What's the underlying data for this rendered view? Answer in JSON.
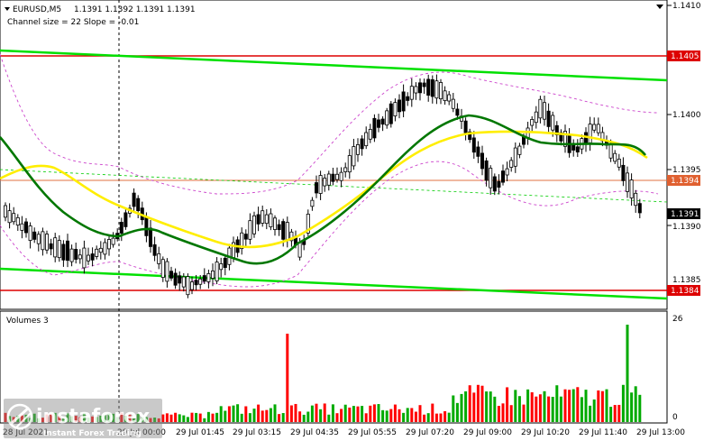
{
  "header": {
    "symbol": "EURUSD,M5",
    "ohlc": "1.1391 1.1392 1.1391 1.1391",
    "indicator": "Channel size = 22 Slope = -0.01"
  },
  "price_axis": {
    "labels": [
      "1.1410",
      "1.1405",
      "1.1400",
      "1.1395",
      "1.1394",
      "1.1391",
      "1.1390",
      "1.1385",
      "1.1384"
    ]
  },
  "volume_panel": {
    "title": "Volumes 3",
    "axis_labels": [
      "26",
      "0"
    ]
  },
  "time_axis": {
    "labels": [
      "28 Jul 2021",
      "29 Jul 00:00",
      "29 Jul 01:45",
      "29 Jul 03:15",
      "29 Jul 04:35",
      "29 Jul 05:55",
      "29 Jul 07:20",
      "29 Jul 09:00",
      "29 Jul 10:20",
      "29 Jul 11:40",
      "29 Jul 13:00"
    ]
  },
  "watermark": {
    "brand": "instaforex",
    "tagline": "Instant Forex Trading"
  },
  "colors": {
    "up_bar": "#00aa00",
    "down_bar": "#ff0000",
    "level_line": "#dd0000",
    "channel_line": "#00e000",
    "ma_fast": "#ffee00",
    "ma_slow": "#007700"
  }
}
